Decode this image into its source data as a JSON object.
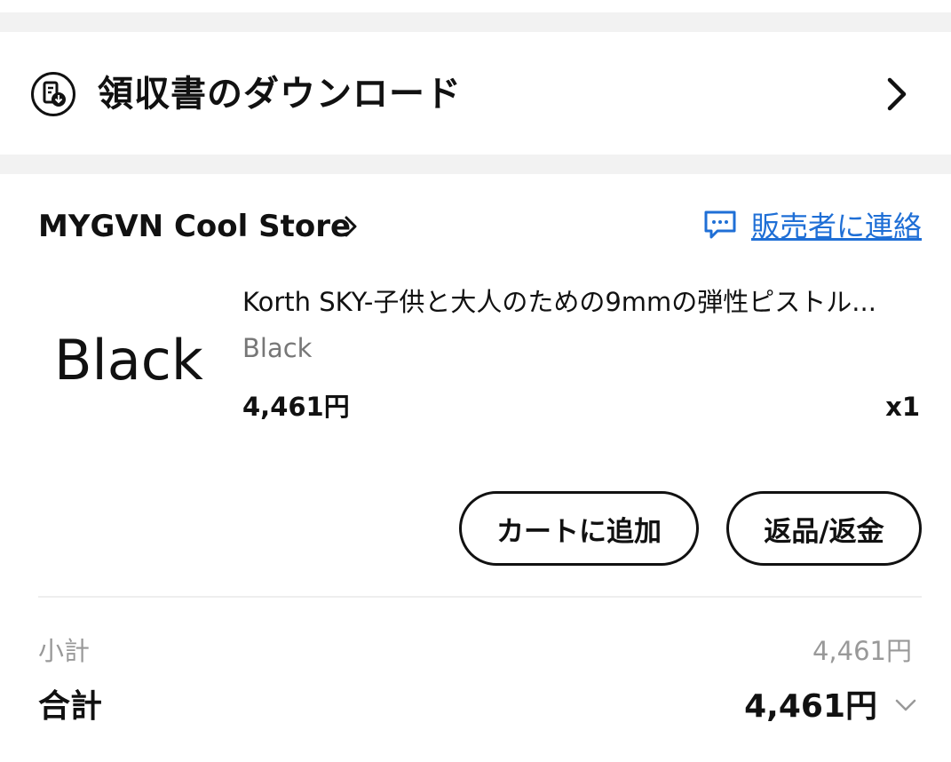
{
  "receipt": {
    "label": "領収書のダウンロード",
    "icon": "receipt-download-icon"
  },
  "store": {
    "name": "MYGVN Cool Store",
    "contact_label": "販売者に連絡",
    "contact_color": "#1f6fd6"
  },
  "product": {
    "thumbnail_text": "Black",
    "title": "Korth SKY-子供と大人のための9mmの弾性ピストル...",
    "variant": "Black",
    "price": "4,461円",
    "quantity": "x1"
  },
  "actions": {
    "add_to_cart": "カートに追加",
    "return_refund": "返品/返金"
  },
  "summary": {
    "subtotal_label": "小計",
    "subtotal_value": "4,461円",
    "total_label": "合計",
    "total_value": "4,461円"
  }
}
